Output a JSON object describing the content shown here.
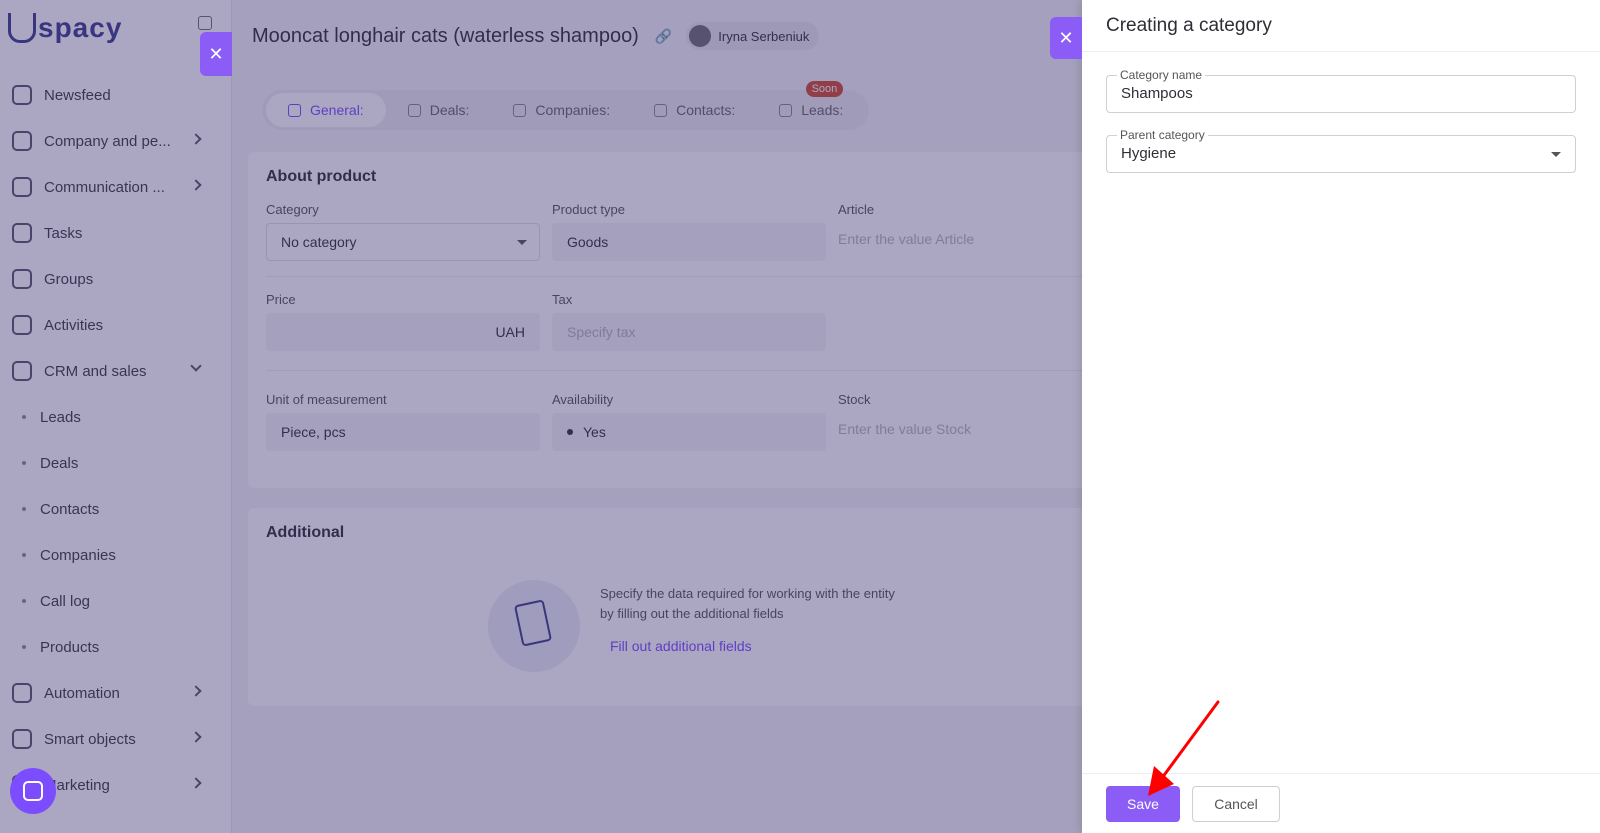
{
  "app": {
    "logo": "spacy"
  },
  "sidebar": {
    "items": [
      {
        "label": "Newsfeed",
        "chevron": false
      },
      {
        "label": "Company and pe...",
        "chevron": true
      },
      {
        "label": "Communication ...",
        "chevron": true
      },
      {
        "label": "Tasks",
        "chevron": false
      },
      {
        "label": "Groups",
        "chevron": false
      },
      {
        "label": "Activities",
        "chevron": false
      },
      {
        "label": "CRM and sales",
        "chevron": true,
        "expanded": true
      }
    ],
    "sub_items": [
      "Leads",
      "Deals",
      "Contacts",
      "Companies",
      "Call log",
      "Products"
    ],
    "bottom_items": [
      {
        "label": "Automation"
      },
      {
        "label": "Smart objects"
      },
      {
        "label": "Marketing"
      }
    ]
  },
  "product": {
    "title": "Mooncat longhair cats (waterless shampoo)",
    "owner": "Iryna Serbeniuk",
    "tabs": [
      {
        "label": "General:",
        "active": true
      },
      {
        "label": "Deals:",
        "active": false
      },
      {
        "label": "Companies:",
        "active": false
      },
      {
        "label": "Contacts:",
        "active": false
      },
      {
        "label": "Leads:",
        "active": false,
        "badge": "Soon"
      }
    ],
    "about": {
      "title": "About product",
      "category_label": "Category",
      "category_value": "No category",
      "type_label": "Product type",
      "type_value": "Goods",
      "article_label": "Article",
      "article_placeholder": "Enter the value Article",
      "price_label": "Price",
      "price_currency": "UAH",
      "tax_label": "Tax",
      "tax_placeholder": "Specify tax",
      "unit_label": "Unit of measurement",
      "unit_value": "Piece, pcs",
      "availability_label": "Availability",
      "availability_value": "Yes",
      "stock_label": "Stock",
      "stock_placeholder": "Enter the value Stock"
    },
    "additional": {
      "title": "Additional",
      "empty_text": "Specify the data required for working with the entity by filling out the additional fields",
      "fill_link": "Fill out additional fields"
    }
  },
  "panel": {
    "title": "Creating a category",
    "category_name_label": "Category name",
    "category_name_value": "Shampoos",
    "parent_category_label": "Parent category",
    "parent_category_value": "Hygiene",
    "save_label": "Save",
    "cancel_label": "Cancel",
    "accent": "#8c5cf6"
  }
}
